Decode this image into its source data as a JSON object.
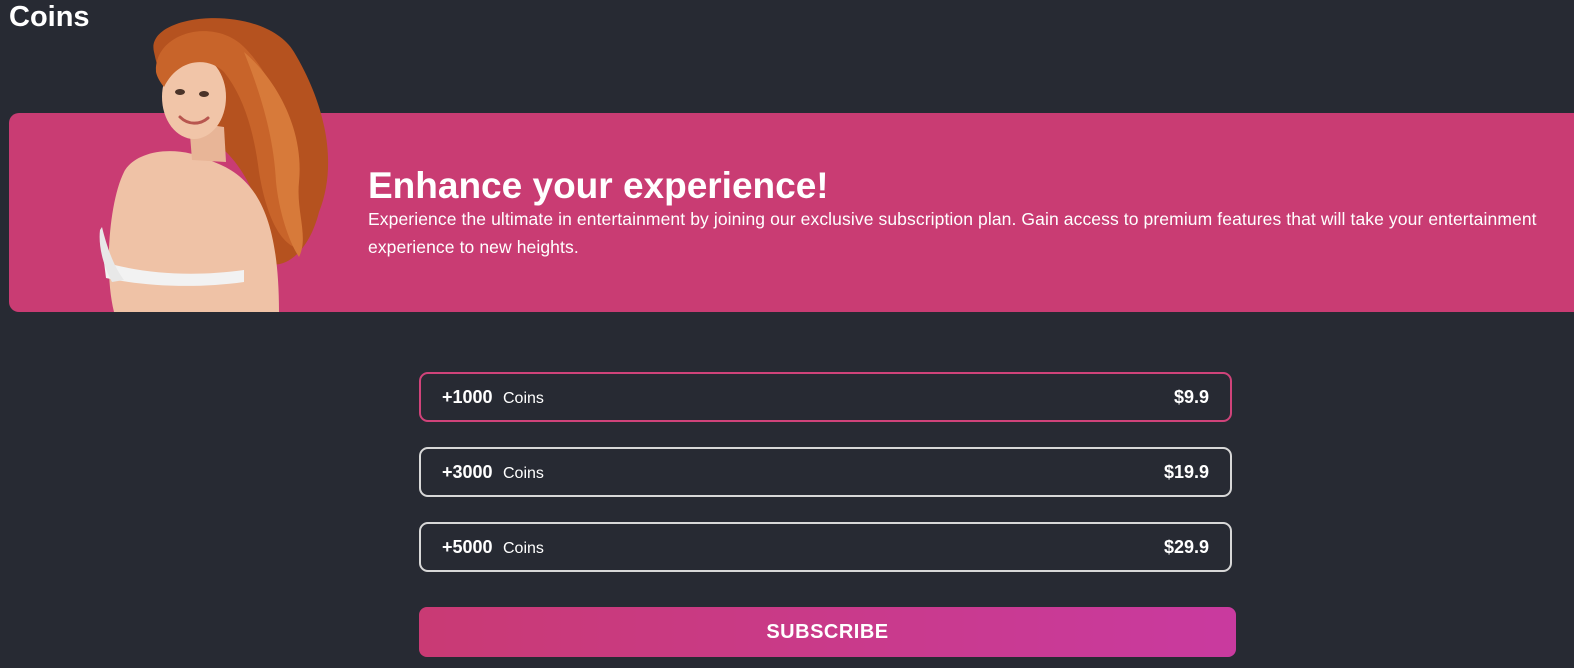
{
  "header": {
    "title": "Coins"
  },
  "banner": {
    "title": "Enhance your experience!",
    "description": "Experience the ultimate in entertainment by joining our exclusive subscription plan. Gain access to premium features that will take your entertainment experience to new heights.",
    "color": "#c93c73"
  },
  "plans": [
    {
      "amount": "+1000",
      "unit": "Coins",
      "price": "$9.9",
      "selected": true
    },
    {
      "amount": "+3000",
      "unit": "Coins",
      "price": "$19.9",
      "selected": false
    },
    {
      "amount": "+5000",
      "unit": "Coins",
      "price": "$29.9",
      "selected": false
    }
  ],
  "subscribe": {
    "label": "SUBSCRIBE"
  },
  "theme": {
    "background": "#272a33",
    "accent": "#c93c73",
    "selected_border": "#d0437a"
  }
}
